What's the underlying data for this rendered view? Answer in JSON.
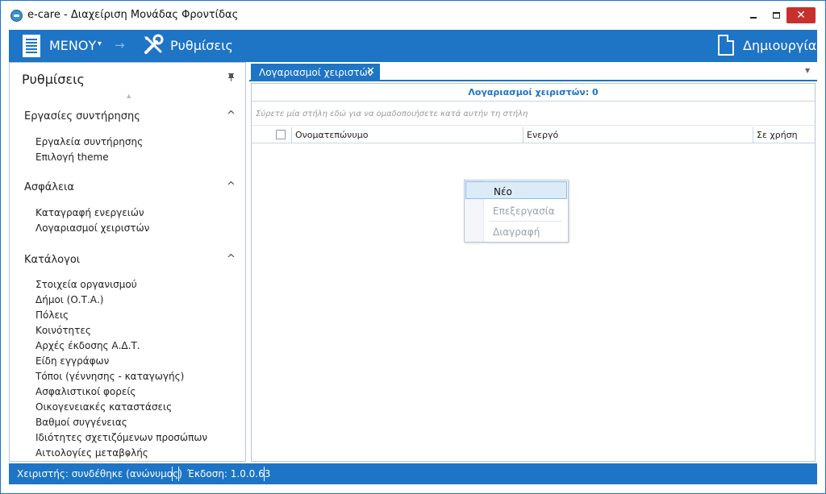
{
  "window": {
    "title": "e-care - Διαχείριση Μονάδας Φροντίδας",
    "close_glyph": "✕"
  },
  "ribbon": {
    "menu_label": "ΜΕΝΟΥ",
    "menu_caret": "▾",
    "breadcrumb_arrow": "→",
    "settings_label": "Ρυθμίσεις",
    "create_label": "Δημιουργία"
  },
  "left_panel": {
    "title": "Ρυθμίσεις",
    "pin_glyph": "📌",
    "groups": [
      {
        "title": "Εργασίες συντήρησης",
        "items": [
          "Εργαλεία συντήρησης",
          "Επιλογή theme"
        ]
      },
      {
        "title": "Ασφάλεια",
        "items": [
          "Καταγραφή ενεργειών",
          "Λογαριασμοί χειριστών"
        ]
      },
      {
        "title": "Κατάλογοι",
        "items": [
          "Στοιχεία οργανισμού",
          "Δήμοι (Ο.Τ.Α.)",
          "Πόλεις",
          "Κοινότητες",
          "Αρχές έκδοσης Α.Δ.Τ.",
          "Είδη εγγράφων",
          "Τόποι (γέννησης - καταγωγής)",
          "Ασφαλιστικοί φορείς",
          "Οικογενειακές καταστάσεις",
          "Βαθμοί συγγένειας",
          "Ιδιότητες σχετιζόμενων προσώπων",
          "Αιτιολογίες μεταβολής"
        ]
      }
    ]
  },
  "tabs": [
    {
      "label": "Λογαριασμοί χειριστών",
      "close_glyph": "✕"
    }
  ],
  "grid": {
    "header": "Λογαριασμοί χειριστών: 0",
    "group_hint": "Σύρετε μία στήλη εδώ για να ομαδοποιήσετε κατά αυτήν τη στήλη",
    "columns": [
      "Ονοματεπώνυμο",
      "Ενεργό",
      "Σε χρήση"
    ]
  },
  "context_menu": {
    "items": [
      {
        "label": "Νέο",
        "state": "highlighted"
      },
      {
        "label": "Επεξεργασία",
        "state": "disabled"
      },
      {
        "label": "Διαγραφή",
        "state": "disabled"
      }
    ]
  },
  "status_bar": {
    "user": "Χειριστής: συνδέθηκε (ανώνυμος)",
    "version": "Έκδοση: 1.0.0.63"
  },
  "colors": {
    "accent": "#1e74c5",
    "close_button": "#c9302c"
  }
}
